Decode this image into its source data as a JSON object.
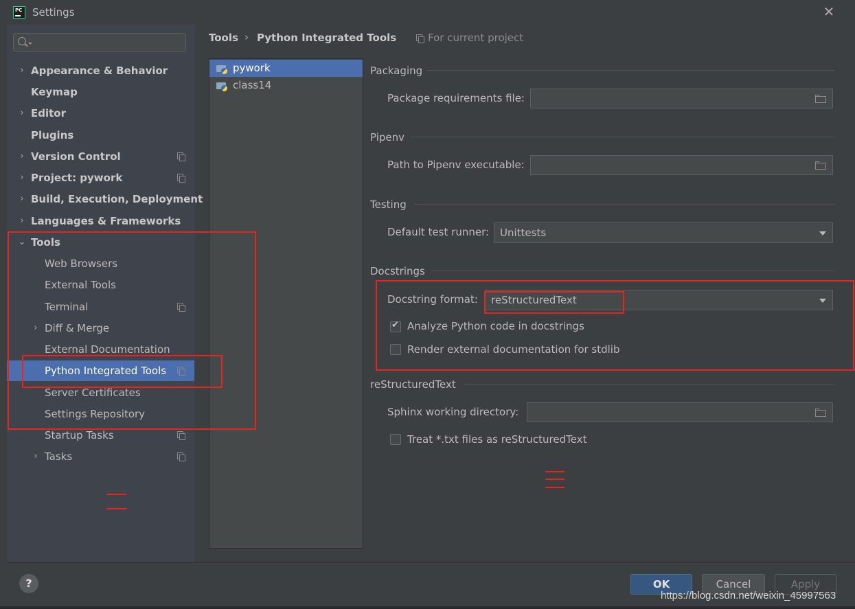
{
  "window": {
    "title": "Settings",
    "close_label": "✕"
  },
  "search": {
    "placeholder": ""
  },
  "sidebar": {
    "items": [
      {
        "label": "Appearance & Behavior",
        "bold": true,
        "chevron": "›",
        "copy_icon": false
      },
      {
        "label": "Keymap",
        "bold": true,
        "chevron": "",
        "copy_icon": false
      },
      {
        "label": "Editor",
        "bold": true,
        "chevron": "›",
        "copy_icon": false
      },
      {
        "label": "Plugins",
        "bold": true,
        "chevron": "",
        "copy_icon": false
      },
      {
        "label": "Version Control",
        "bold": true,
        "chevron": "›",
        "copy_icon": true
      },
      {
        "label": "Project: pywork",
        "bold": true,
        "chevron": "›",
        "copy_icon": true
      },
      {
        "label": "Build, Execution, Deployment",
        "bold": true,
        "chevron": "›",
        "copy_icon": false
      },
      {
        "label": "Languages & Frameworks",
        "bold": true,
        "chevron": "›",
        "copy_icon": false
      },
      {
        "label": "Tools",
        "bold": true,
        "chevron": "⌄",
        "copy_icon": false
      },
      {
        "label": "Web Browsers",
        "bold": false,
        "chevron": "",
        "copy_icon": false
      },
      {
        "label": "External Tools",
        "bold": false,
        "chevron": "",
        "copy_icon": false
      },
      {
        "label": "Terminal",
        "bold": false,
        "chevron": "",
        "copy_icon": true
      },
      {
        "label": "Diff & Merge",
        "bold": false,
        "chevron": "›",
        "copy_icon": false
      },
      {
        "label": "External Documentation",
        "bold": false,
        "chevron": "",
        "copy_icon": false
      },
      {
        "label": "Python Integrated Tools",
        "bold": false,
        "chevron": "",
        "copy_icon": true,
        "selected": true
      },
      {
        "label": "Server Certificates",
        "bold": false,
        "chevron": "",
        "copy_icon": false
      },
      {
        "label": "Settings Repository",
        "bold": false,
        "chevron": "",
        "copy_icon": false
      },
      {
        "label": "Startup Tasks",
        "bold": false,
        "chevron": "",
        "copy_icon": true
      },
      {
        "label": "Tasks",
        "bold": false,
        "chevron": "›",
        "copy_icon": true
      }
    ]
  },
  "breadcrumb": {
    "parent": "Tools",
    "separator": "›",
    "current": "Python Integrated Tools",
    "scope": "For current project"
  },
  "projects": [
    {
      "label": "pywork",
      "selected": true
    },
    {
      "label": "class14",
      "selected": false
    }
  ],
  "packaging": {
    "title": "Packaging",
    "requirements_label": "Package requirements file:",
    "requirements_value": ""
  },
  "pipenv": {
    "title": "Pipenv",
    "path_label": "Path to Pipenv executable:",
    "path_value": ""
  },
  "testing": {
    "title": "Testing",
    "runner_label": "Default test runner:",
    "runner_value": "Unittests"
  },
  "docstrings": {
    "title": "Docstrings",
    "format_label": "Docstring format:",
    "format_value": "reStructuredText",
    "analyze_label": "Analyze Python code in docstrings",
    "analyze_checked": true,
    "render_label": "Render external documentation for stdlib",
    "render_checked": false
  },
  "restructuredtext": {
    "title": "reStructuredText",
    "sphinx_label": "Sphinx working directory:",
    "sphinx_value": "",
    "treat_label": "Treat *.txt files as reStructuredText",
    "treat_checked": false
  },
  "annotations": {
    "color": "#e8241c"
  },
  "footer": {
    "help_label": "?",
    "ok_label": "OK",
    "cancel_label": "Cancel",
    "apply_label": "Apply"
  },
  "watermark": "https://blog.csdn.net/weixin_45997563",
  "colors": {
    "selection": "#4b6eaf",
    "panel": "#3c3f41",
    "sidebar": "#3e434c",
    "annotation": "#e8241c"
  }
}
